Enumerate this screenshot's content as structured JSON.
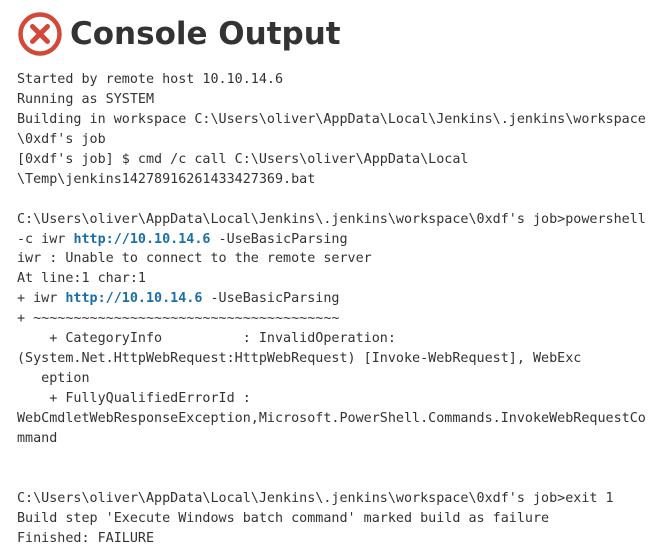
{
  "header": {
    "title": "Console Output",
    "icon": "failure-icon",
    "icon_color": "#d24939"
  },
  "link_color": "#1a6fa8",
  "console": {
    "lines": [
      [
        {
          "t": "Started by remote host 10.10.14.6"
        }
      ],
      [
        {
          "t": "Running as SYSTEM"
        }
      ],
      [
        {
          "t": "Building in workspace C:\\Users\\oliver\\AppData\\Local\\Jenkins\\.jenkins\\workspace"
        }
      ],
      [
        {
          "t": "\\0xdf's job"
        }
      ],
      [
        {
          "t": "[0xdf's job] $ cmd /c call C:\\Users\\oliver\\AppData\\Local"
        }
      ],
      [
        {
          "t": "\\Temp\\jenkins14278916261433427369.bat"
        }
      ],
      [
        {
          "t": ""
        }
      ],
      [
        {
          "t": "C:\\Users\\oliver\\AppData\\Local\\Jenkins\\.jenkins\\workspace\\0xdf's job>powershell"
        }
      ],
      [
        {
          "t": "-c iwr "
        },
        {
          "t": "http://10.10.14.6",
          "link": true
        },
        {
          "t": " -UseBasicParsing"
        }
      ],
      [
        {
          "t": "iwr : Unable to connect to the remote server"
        }
      ],
      [
        {
          "t": "At line:1 char:1"
        }
      ],
      [
        {
          "t": "+ iwr "
        },
        {
          "t": "http://10.10.14.6",
          "link": true
        },
        {
          "t": " -UseBasicParsing"
        }
      ],
      [
        {
          "t": "+ ~~~~~~~~~~~~~~~~~~~~~~~~~~~~~~~~~~~~~~"
        }
      ],
      [
        {
          "t": "    + CategoryInfo          : InvalidOperation:"
        }
      ],
      [
        {
          "t": "(System.Net.HttpWebRequest:HttpWebRequest) [Invoke-WebRequest], WebExc"
        }
      ],
      [
        {
          "t": "   eption"
        }
      ],
      [
        {
          "t": "    + FullyQualifiedErrorId :"
        }
      ],
      [
        {
          "t": "WebCmdletWebResponseException,Microsoft.PowerShell.Commands.InvokeWebRequestCo"
        }
      ],
      [
        {
          "t": "mmand"
        }
      ],
      [
        {
          "t": ""
        }
      ],
      [
        {
          "t": ""
        }
      ],
      [
        {
          "t": "C:\\Users\\oliver\\AppData\\Local\\Jenkins\\.jenkins\\workspace\\0xdf's job>exit 1"
        }
      ],
      [
        {
          "t": "Build step 'Execute Windows batch command' marked build as failure"
        }
      ],
      [
        {
          "t": "Finished: FAILURE"
        }
      ]
    ]
  }
}
